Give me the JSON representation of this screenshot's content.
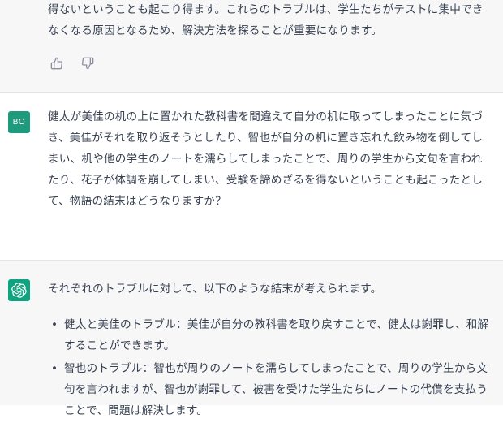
{
  "previous_response": {
    "lines": [
      "得ないということも起こり得ます。これらのトラブルは、学生たちがテストに集中でき",
      "なくなる原因となるため、解決方法を探ることが重要になります。"
    ],
    "feedback": {
      "thumbs_up_icon": "thumbs-up-icon",
      "thumbs_down_icon": "thumbs-down-icon"
    }
  },
  "user_message": {
    "avatar_initials": "BO",
    "avatar_color": "#1e9b7d",
    "lines": [
      "健太が美佳の机の上に置かれた教科書を間違えて自分の机に取ってしまったことに気づ",
      "き、美佳がそれを取り返そうとしたり、智也が自分の机に置き忘れた飲み物を倒してし",
      "まい、机や他の学生のノートを濡らしてしまったことで、周りの学生から文句を言われ",
      "たり、花子が体調を崩してしまい、受験を諦めざるを得ないということも起こったとし",
      "て、物語の結末はどうなりますか？"
    ]
  },
  "assistant_message": {
    "avatar_icon": "openai-logo-icon",
    "avatar_color": "#10a37f",
    "intro": "それぞれのトラブルに対して、以下のような結末が考えられます。",
    "bullets": [
      {
        "lines": [
          "健太と美佳のトラブル：美佳が自分の教科書を取り戻すことで、健太は謝罪し、和解",
          "することができます。"
        ]
      },
      {
        "lines": [
          "智也のトラブル：智也が周りのノートを濡らしてしまったことで、周りの学生から文",
          "句を言われますが、智也が謝罪して、被害を受けた学生たちにノートの代償を支払う",
          "ことで、問題は解決します。"
        ]
      }
    ]
  }
}
